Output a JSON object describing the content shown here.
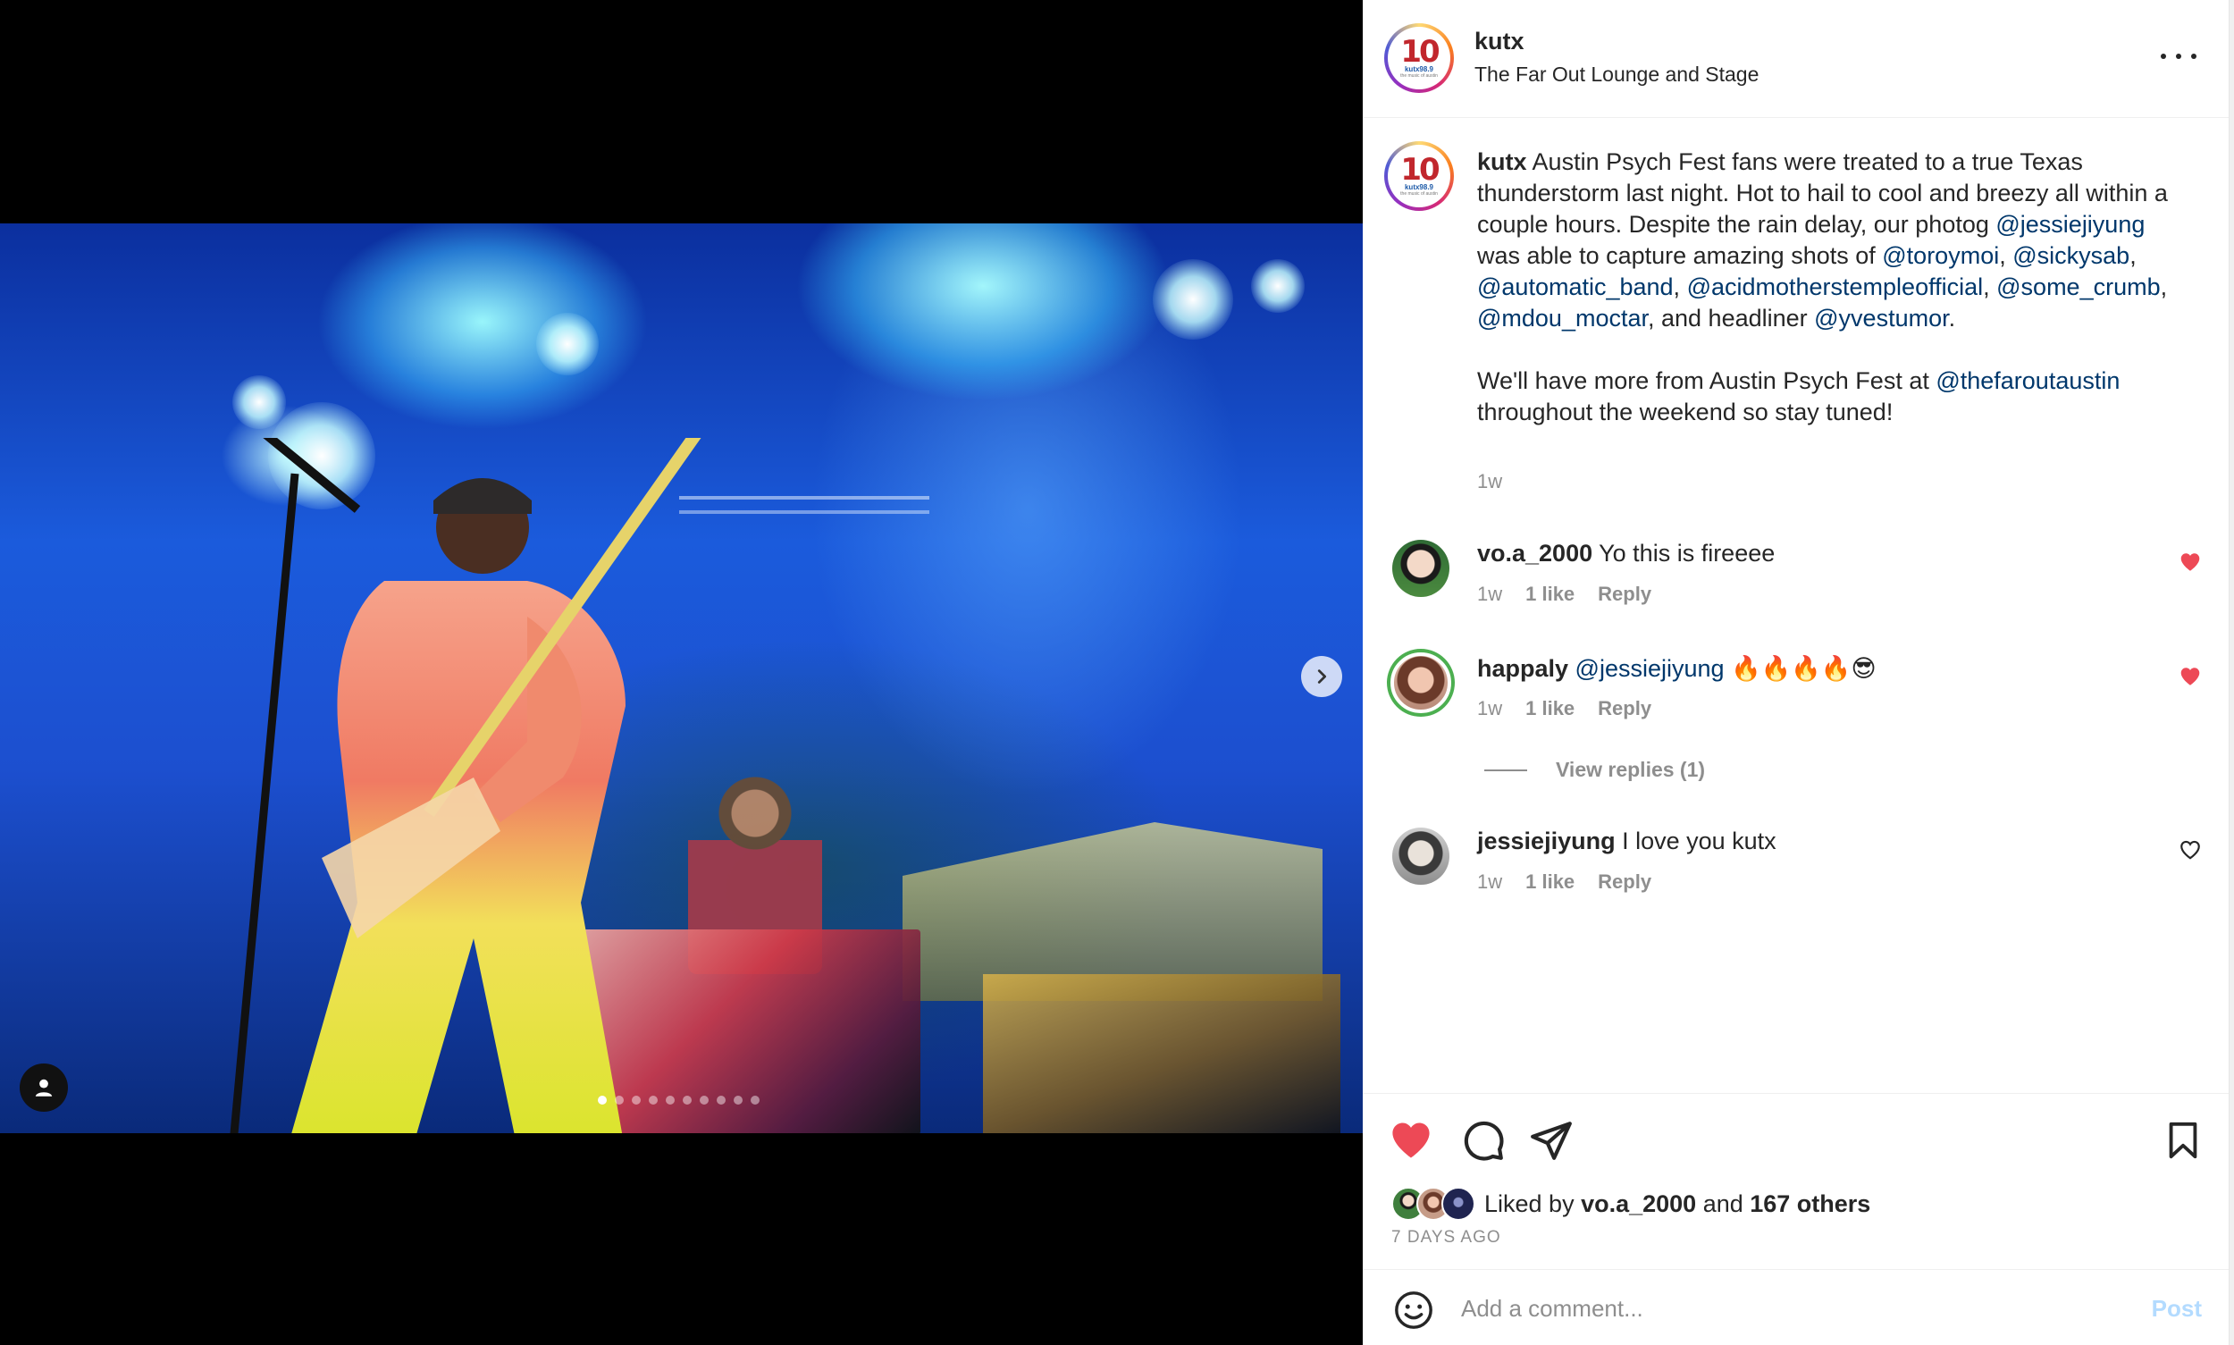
{
  "post": {
    "username": "kutx",
    "location": "The Far Out Lounge and Stage",
    "logo_text": {
      "big": "10",
      "small": "kutx98.9",
      "tiny": "the music of austin"
    },
    "caption": {
      "username": "kutx",
      "p1_a": " Austin Psych Fest fans were treated to a true Texas thunderstorm last night. Hot to hail to cool and breezy all within a couple hours. Despite the rain delay, our photog ",
      "m_jessie": "@jessiejiyung",
      "p1_b": " was able to capture amazing shots of ",
      "m_toro": "@toroymoi",
      "sep1": ", ",
      "m_sicky": "@sickysab",
      "sep2": ", ",
      "m_auto": "@automatic_band",
      "sep3": ", ",
      "m_acid": "@acidmotherstempleofficial",
      "sep4": ", ",
      "m_crumb": "@some_crumb",
      "sep5": ", ",
      "m_mdou": "@mdou_moctar",
      "p1_c": ", and headliner ",
      "m_yves": "@yvestumor",
      "p1_d": ".",
      "p2_a": "We'll have more from Austin Psych Fest at ",
      "m_farout": "@thefaroutaustin",
      "p2_b": " throughout the weekend so stay tuned!",
      "time": "1w"
    },
    "carousel": {
      "total": 10,
      "active_index": 0
    }
  },
  "comments": [
    {
      "user": "vo.a_2000",
      "text": "Yo this is fireeee",
      "mention": "",
      "time": "1w",
      "likes": "1 like",
      "reply": "Reply",
      "liked": true
    },
    {
      "user": "happaly",
      "mention": "@jessiejiyung",
      "text": " 🔥🔥🔥🔥😎",
      "time": "1w",
      "likes": "1 like",
      "reply": "Reply",
      "liked": true
    },
    {
      "user": "jessiejiyung",
      "text": "I love you kutx",
      "mention": "",
      "time": "1w",
      "likes": "1 like",
      "reply": "Reply",
      "liked": false
    }
  ],
  "view_replies": "View replies (1)",
  "likes": {
    "prefix": "Liked by ",
    "user": "vo.a_2000",
    "middle": " and ",
    "others": "167 others"
  },
  "post_date": "7 DAYS AGO",
  "comment_box": {
    "placeholder": "Add a comment...",
    "post_label": "Post"
  },
  "colors": {
    "liked_red": "#ed4956",
    "link_blue": "#00376b",
    "post_btn_disabled": "#b3dbff"
  }
}
